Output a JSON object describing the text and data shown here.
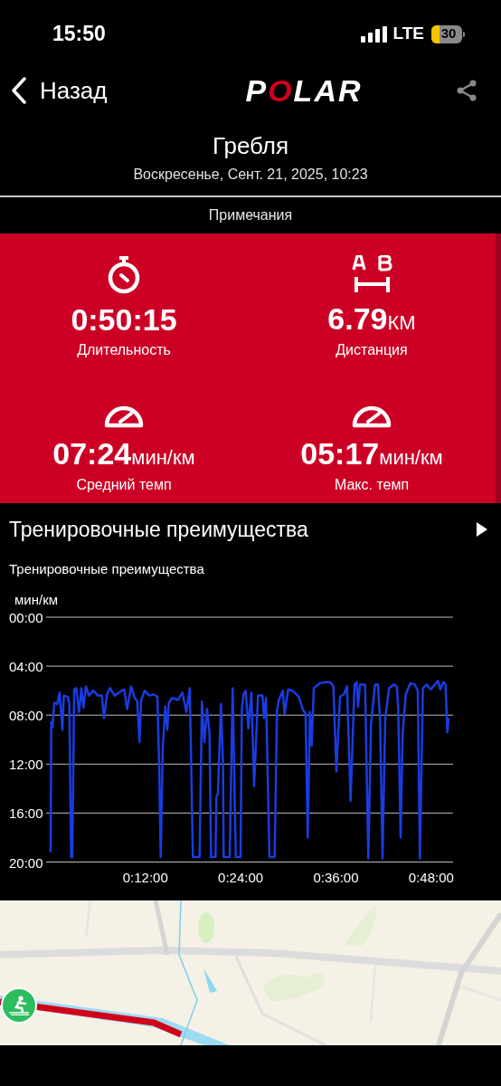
{
  "status_bar": {
    "time": "15:50",
    "network": "LTE",
    "battery": "30"
  },
  "header": {
    "back": "Назад",
    "logo": "POLAR"
  },
  "title": "Гребля",
  "date": "Воскресенье, Сент. 21, 2025, 10:23",
  "notes_tab": "Примечания",
  "metrics": [
    {
      "kind": "stopwatch",
      "value": "0:50:15",
      "label": "Длительность"
    },
    {
      "kind": "distance",
      "value": "6.79",
      "unit": "КМ",
      "label": "Дистанция"
    },
    {
      "kind": "speedometer",
      "value": "07:24",
      "unit": "мин/км",
      "label": "Средний темп"
    },
    {
      "kind": "speedometer",
      "value": "05:17",
      "unit": "мин/км",
      "label": "Макс. темп"
    }
  ],
  "section": {
    "title": "Тренировочные преимущества",
    "subtitle": "Тренировочные преимущества",
    "chart_data": {
      "type": "line",
      "ylabel": "мин/км",
      "xlim": [
        -0.5,
        50.75
      ],
      "ylim": [
        20,
        0
      ],
      "grid": true,
      "yticks": [
        {
          "value": 0,
          "label": "00:00"
        },
        {
          "value": 4,
          "label": "04:00"
        },
        {
          "value": 8,
          "label": "08:00"
        },
        {
          "value": 12,
          "label": "12:00"
        },
        {
          "value": 16,
          "label": "16:00"
        },
        {
          "value": 20,
          "label": "20:00"
        }
      ],
      "xticks": [
        {
          "value": 12,
          "label": "0:12:00"
        },
        {
          "value": 24,
          "label": "0:24:00"
        },
        {
          "value": 36,
          "label": "0:36:00"
        },
        {
          "value": 48,
          "label": "0:48:00"
        }
      ],
      "x": [
        0.07,
        0.15,
        0.3,
        0.52,
        0.9,
        1.2,
        1.55,
        1.73,
        2.23,
        2.42,
        2.65,
        2.8,
        3.03,
        3.29,
        3.64,
        3.94,
        4.2,
        4.51,
        4.89,
        5.46,
        6.0,
        6.52,
        6.79,
        7.17,
        7.55,
        8.12,
        8.69,
        9.33,
        9.71,
        10.2,
        10.6,
        10.97,
        11.27,
        11.46,
        11.9,
        12.48,
        13.05,
        13.51,
        13.74,
        13.93,
        14.19,
        14.5,
        14.76,
        14.95,
        15.33,
        16.1,
        16.66,
        17.15,
        17.6,
        17.98,
        18.83,
        19.12,
        19.43,
        19.77,
        20.08,
        20.26,
        20.83,
        20.95,
        21.14,
        21.51,
        21.78,
        21.86,
        22.62,
        23.0,
        23.38,
        23.99,
        24.14,
        24.36,
        24.63,
        24.97,
        25.35,
        25.7,
        26.18,
        26.75,
        26.94,
        27.2,
        27.63,
        28.28,
        28.58,
        28.83,
        29.3,
        29.53,
        29.99,
        30.56,
        31.31,
        31.88,
        32.18,
        32.45,
        32.72,
        32.95,
        33.21,
        33.97,
        34.72,
        35.29,
        35.68,
        36.06,
        36.51,
        37.0,
        37.39,
        37.85,
        38.34,
        38.6,
        38.79,
        39.02,
        39.67,
        40.08,
        40.42,
        40.92,
        41.3,
        41.56,
        41.87,
        42.21,
        42.7,
        43.27,
        43.66,
        43.84,
        44.15,
        44.41,
        44.79,
        45.36,
        45.93,
        46.31,
        46.57,
        46.96,
        47.45,
        47.9,
        48.28,
        48.85,
        49.16,
        49.53,
        49.8,
        50.03,
        50.18
      ],
      "series": [
        {
          "color": "#1a3ce0",
          "values": [
            19.2,
            8.6,
            9.0,
            7.0,
            7.1,
            6.15,
            9.2,
            6.4,
            6.5,
            7.0,
            19.6,
            19.6,
            5.9,
            5.8,
            7.75,
            5.8,
            7.4,
            5.65,
            6.4,
            6.0,
            6.4,
            6.4,
            8.25,
            6.3,
            5.8,
            6.4,
            6.15,
            5.9,
            7.5,
            5.65,
            6.5,
            6.9,
            10.2,
            6.8,
            6.0,
            6.4,
            6.3,
            6.5,
            12,
            19.6,
            10.7,
            7.3,
            9.2,
            7.0,
            6.6,
            6.75,
            6.15,
            7.75,
            5.8,
            19.6,
            19.6,
            6.9,
            10.2,
            7.5,
            9.5,
            19.6,
            19.6,
            14.7,
            14.4,
            7.1,
            12,
            19.6,
            19.6,
            5.8,
            19.6,
            19.6,
            7.6,
            6.3,
            6.0,
            9.1,
            6.15,
            13.8,
            6.4,
            6.4,
            8.25,
            6.6,
            19.6,
            19.6,
            7.6,
            6.75,
            6.0,
            7.9,
            5.9,
            6.0,
            6.5,
            7.6,
            7.9,
            18.0,
            7.75,
            10.5,
            5.8,
            5.4,
            5.3,
            5.3,
            5.65,
            12.6,
            6.5,
            6.3,
            5.65,
            15.0,
            5.5,
            5.3,
            7.3,
            5.5,
            5.5,
            19.7,
            8.7,
            5.5,
            5.5,
            8.5,
            19.7,
            8.25,
            5.8,
            5.5,
            5.65,
            7.3,
            18.0,
            9.5,
            6.3,
            5.4,
            5.5,
            6.0,
            19.7,
            5.8,
            5.5,
            5.9,
            5.65,
            5.2,
            5.9,
            5.3,
            5.5,
            9.4,
            8.25
          ]
        }
      ]
    }
  }
}
